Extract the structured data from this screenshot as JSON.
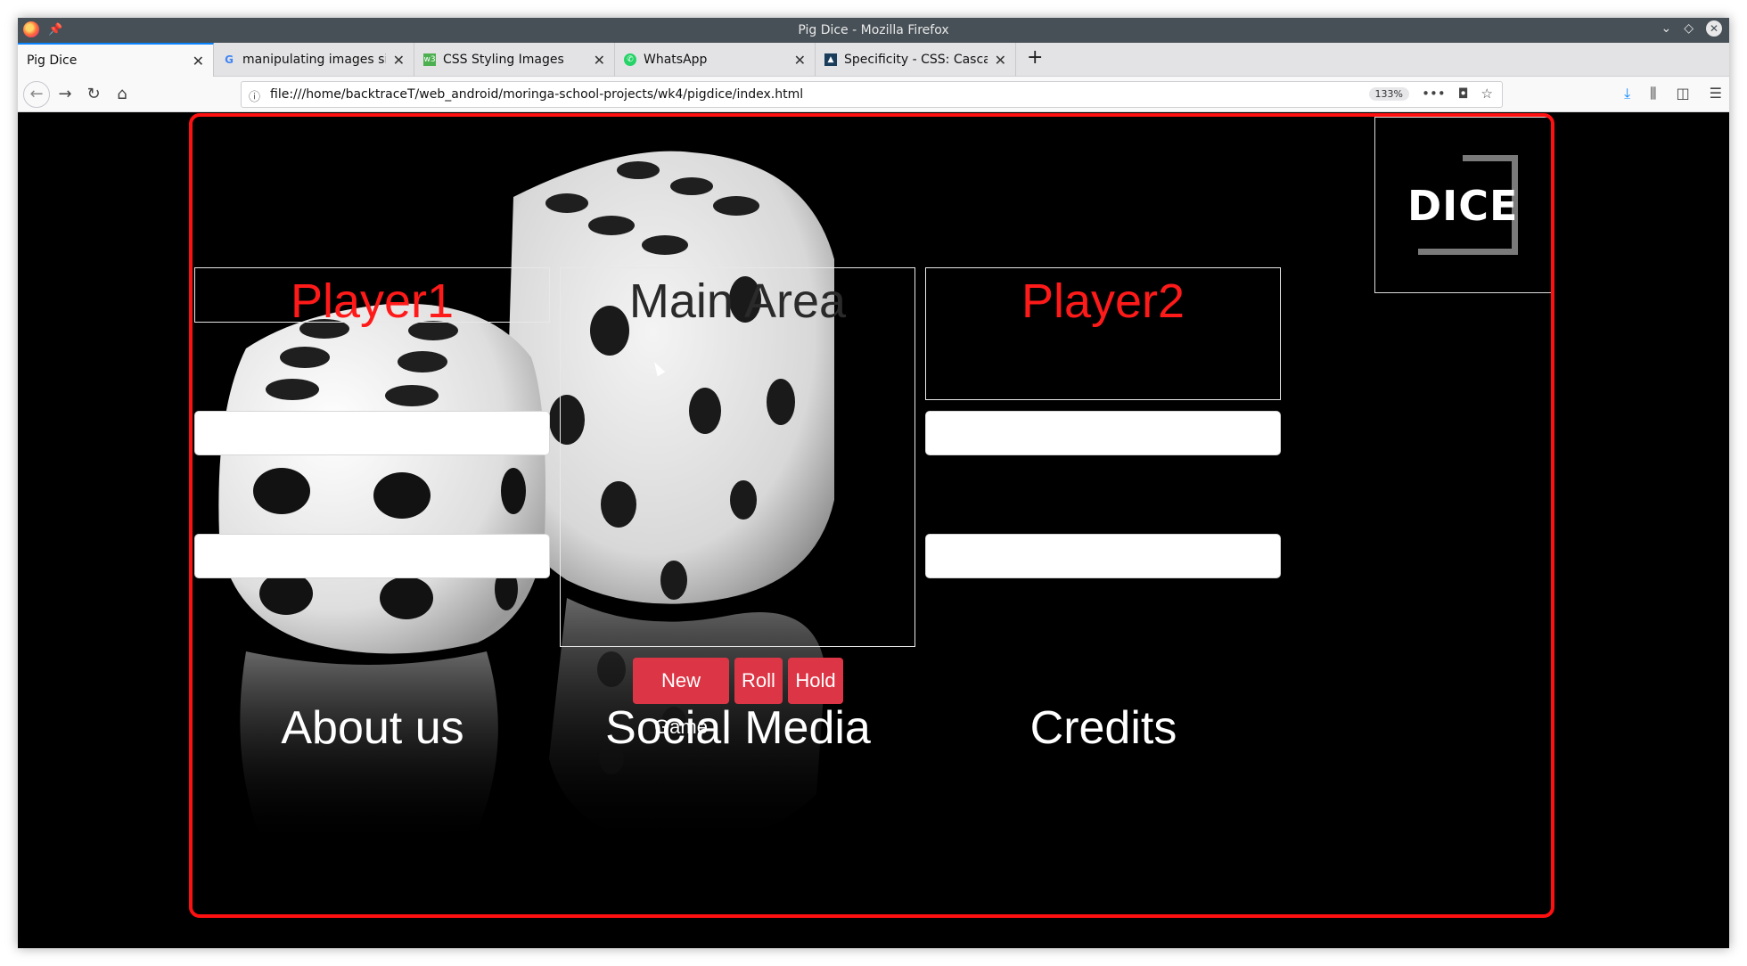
{
  "window": {
    "title": "Pig Dice - Mozilla Firefox"
  },
  "tabs": [
    {
      "label": "Pig Dice",
      "icon": "none",
      "active": true
    },
    {
      "label": "manipulating images sizes",
      "icon": "google-icon"
    },
    {
      "label": "CSS Styling Images",
      "icon": "w3schools-icon"
    },
    {
      "label": "WhatsApp",
      "icon": "whatsapp-icon"
    },
    {
      "label": "Specificity - CSS: Cascading",
      "icon": "mdn-icon"
    }
  ],
  "navbar": {
    "url": "file:///home/backtraceT/web_android/moringa-school-projects/wk4/pigdice/index.html",
    "zoom": "133%"
  },
  "page": {
    "logo_text": "DICE",
    "player1_title": "Player1",
    "player2_title": "Player2",
    "main_title": "Main Area",
    "buttons": {
      "new_game": "New Game",
      "roll": "Roll",
      "hold": "Hold"
    },
    "footer": {
      "about": "About us",
      "social": "Social Media",
      "credits": "Credits"
    },
    "colors": {
      "frame_border": "#ff1010",
      "player_title": "#ff1a1a",
      "button_bg": "#dc3545"
    }
  }
}
